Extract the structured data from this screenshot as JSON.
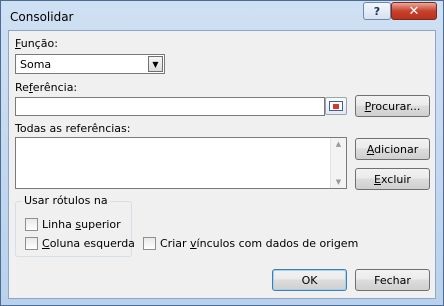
{
  "window": {
    "title": "Consolidar",
    "help_label": "?",
    "close_label": "✕"
  },
  "funcao": {
    "label_u": "F",
    "label_rest": "unção:",
    "selected": "Soma"
  },
  "referencia": {
    "label_pre": "Re",
    "label_u": "f",
    "label_post": "erência:",
    "value": ""
  },
  "procurar": {
    "label_u": "P",
    "label_rest": "rocurar..."
  },
  "todas": {
    "label": "Todas as referências:"
  },
  "adicionar": {
    "label_u": "A",
    "label_rest": "dicionar"
  },
  "excluir": {
    "label_u": "E",
    "label_rest": "xcluir"
  },
  "rotulos": {
    "title": "Usar rótulos na",
    "linha_pre": "Linha ",
    "linha_u": "s",
    "linha_post": "uperior",
    "linha_checked": false,
    "coluna_u": "C",
    "coluna_post": "oluna esquerda",
    "coluna_checked": false
  },
  "vinculos": {
    "pre": "Criar ",
    "u": "v",
    "post": "ínculos com dados de origem",
    "checked": false
  },
  "buttons": {
    "ok": "OK",
    "fechar": "Fechar"
  }
}
